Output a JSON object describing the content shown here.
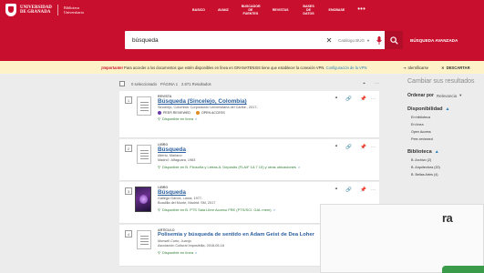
{
  "brand": {
    "line1": "UNIVERSIDAD",
    "line2": "DE GRANADA",
    "lib1": "Biblioteca",
    "lib2": "Universitaria"
  },
  "nav": [
    {
      "label": "BASICO"
    },
    {
      "label": "AVANZ"
    },
    {
      "label": "BUSCADOR DE FUENTES"
    },
    {
      "label": "REVISTAS"
    },
    {
      "label": "BASES DE DATOS"
    },
    {
      "label": "ENOBASE"
    },
    {
      "label": "•••"
    }
  ],
  "search": {
    "value": "búsqueda",
    "scope": "Catálogo BUG",
    "advanced": "BÚSQUEDA AVANZADA"
  },
  "notice": {
    "important": "¡Importante!",
    "text": "Para acceder a los documentos que estén disponibles en línea en GRANATENSIS tiene que establecer la conexión VPN.",
    "link": "Configuración de la VPN",
    "identify": "Identificarse",
    "dismiss": "DESCARTAR"
  },
  "results_bar": {
    "selected": "0 seleccionado",
    "page": "PÁGINA 1",
    "count": "2.871 Resultados"
  },
  "results": [
    {
      "num": "1",
      "type": "REVISTA",
      "title": "Búsqueda (Sincelejo, Colombia)",
      "meta1": "Sincelejo, Colombia: Corporación Universitaria del Caribe., 2017-",
      "badge1": "PEER REVIEWED",
      "badge2": "OPEN ACCESS",
      "avail": "Disponible en línea",
      "avail_extra": ">"
    },
    {
      "num": "2",
      "type": "LIBRO",
      "title": "Búsqueda",
      "meta1": "Alterio, Mariano",
      "meta2": "Madrid : Alfaguara, 1983",
      "avail": "Disponible en B. Filosofía y Letras A. Depósito (FLA/F 1A 7 10) y otras ubicaciones",
      "avail_extra": ">"
    },
    {
      "num": "3",
      "type": "LIBRO",
      "title": "Búsqueda",
      "meta1": "Gallego García, Laura, 1977-",
      "meta2": "Boadilla del Monte, Madrid: SM, 2017",
      "avail": "Disponible en B. PTS  Sala Libre Acceso FRE (PTS/SCI. GAL mem)",
      "avail_extra": ">"
    },
    {
      "num": "4",
      "type": "ARTÍCULO",
      "title": "Polisemia y búsqueda de sentido en Adam Geist de Dea Loher",
      "meta1": "Monsell Curto, Juanjo",
      "meta2": "Asociación Cultural Imposibilia, 2018-05-16",
      "avail": "Disponible en línea",
      "avail_extra": ">"
    }
  ],
  "sidebar": {
    "heading": "Cambiar sus resultados",
    "sort_label": "Ordenar por",
    "sort_value": "Relevancia",
    "facets": [
      {
        "title": "Disponibilidad",
        "items": [
          "En biblioteca",
          "En línea",
          "Open Access",
          "Peer-reviewed"
        ]
      },
      {
        "title": "Biblioteca",
        "items": [
          "B. Archivo (2)",
          "B. Arquitectura (20)",
          "B. Bellas Artes (4)"
        ]
      }
    ]
  },
  "overlay": {
    "text": "ra"
  },
  "colors": {
    "brand_red": "#c8102e",
    "link_blue": "#2b5f9e",
    "avail_green": "#2e7d32",
    "notice_bg": "#fdf2c8"
  }
}
